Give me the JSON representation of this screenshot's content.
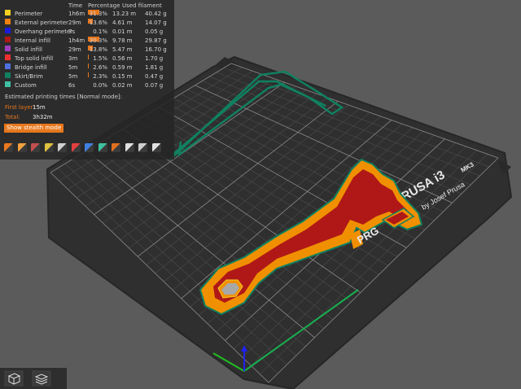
{
  "header": {
    "time": "Time",
    "percentage": "Percentage",
    "used_filament": "Used filament"
  },
  "features": [
    {
      "name": "Perimeter",
      "time": "1h6m",
      "percentage": "31.3%",
      "pct_value": 31.3,
      "length": "13.23 m",
      "weight": "40.42 g",
      "color": "#f5d020"
    },
    {
      "name": "External perimeter",
      "time": "29m",
      "percentage": "13.6%",
      "pct_value": 13.6,
      "length": "4.61 m",
      "weight": "14.07 g",
      "color": "#f08010"
    },
    {
      "name": "Overhang perimeter",
      "time": "7s",
      "percentage": "0.1%",
      "pct_value": 0.1,
      "length": "0.01 m",
      "weight": "0.05 g",
      "color": "#1a1ae0"
    },
    {
      "name": "Internal infill",
      "time": "1h4m",
      "percentage": "30.3%",
      "pct_value": 30.3,
      "length": "9.78 m",
      "weight": "29.87 g",
      "color": "#b01818"
    },
    {
      "name": "Solid infill",
      "time": "29m",
      "percentage": "13.8%",
      "pct_value": 13.8,
      "length": "5.47 m",
      "weight": "16.70 g",
      "color": "#a040c0"
    },
    {
      "name": "Top solid infill",
      "time": "3m",
      "percentage": "1.5%",
      "pct_value": 1.5,
      "length": "0.56 m",
      "weight": "1.70 g",
      "color": "#f03030"
    },
    {
      "name": "Bridge infill",
      "time": "5m",
      "percentage": "2.6%",
      "pct_value": 2.6,
      "length": "0.59 m",
      "weight": "1.81 g",
      "color": "#5070e0"
    },
    {
      "name": "Skirt/Brim",
      "time": "5m",
      "percentage": "2.3%",
      "pct_value": 2.3,
      "length": "0.15 m",
      "weight": "0.47 g",
      "color": "#108060"
    },
    {
      "name": "Custom",
      "time": "6s",
      "percentage": "0.0%",
      "pct_value": 0.0,
      "length": "0.02 m",
      "weight": "0.07 g",
      "color": "#40c0a0"
    }
  ],
  "estimate": {
    "title": "Estimated printing times [Normal mode]:",
    "first_layer_label": "First layer:",
    "first_layer_value": "15m",
    "total_label": "Total:",
    "total_value": "3h32m",
    "stealth_button": "Show stealth mode"
  },
  "legend_icons": [
    "travel-icon",
    "wipe-icon",
    "retraction-icon",
    "deretraction-icon",
    "seam-icon",
    "tool-change-icon",
    "color-change-icon",
    "pause-icon",
    "custom-gcode-icon",
    "center-of-gravity-icon",
    "shells-icon",
    "tool-marker-icon"
  ],
  "bed": {
    "logo_line1": "PRUSA i3",
    "logo_model": "MK3",
    "logo_line2": "by Josef Prusa"
  },
  "part": {
    "label": "PRG"
  },
  "colors": {
    "accent": "#e8781e",
    "bed": "#2f2f2f",
    "grid": "#4c4c4c",
    "model_orange": "#f09000",
    "model_red": "#b01818"
  }
}
